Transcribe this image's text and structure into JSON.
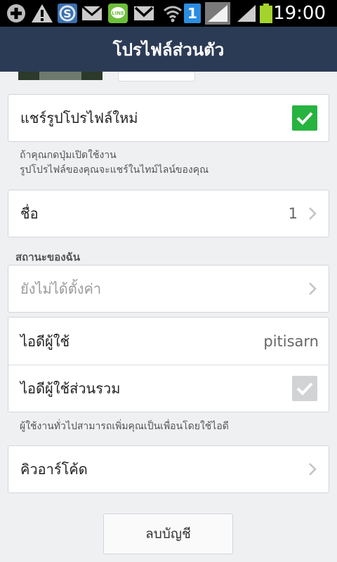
{
  "status_bar": {
    "time": "19:00",
    "notification_badge": "1",
    "battery_color": "#a4d42c",
    "icons": [
      "add-icon",
      "warning-icon",
      "skype-icon",
      "mail-icon",
      "line-icon",
      "gmail-icon",
      "wifi-icon",
      "notification-badge",
      "signal-icon",
      "signal-icon",
      "battery-icon"
    ]
  },
  "header": {
    "title": "โปรไฟล์ส่วนตัว"
  },
  "share_profile": {
    "label": "แชร์รูปโปรไฟล์ใหม่",
    "checked": true,
    "note_line1": "ถ้าคุณกดปุ่มเปิดใช้งาน",
    "note_line2": "รูปโปรไฟล์ของคุณจะแชร์ในไทม์ไลน์ของคุณ"
  },
  "name_row": {
    "label": "ชื่อ",
    "value": "1"
  },
  "status_section": {
    "title": "สถานะของฉัน",
    "placeholder": "ยังไม่ได้ตั้งค่า"
  },
  "user_id": {
    "label": "ไอดีผู้ใช้",
    "value": "pitisarn",
    "public_label": "ไอดีผู้ใช้ส่วนรวม",
    "public_checked": true,
    "note": "ผู้ใช้งานทั่วไปสามารถเพิ่มคุณเป็นเพื่อนโดยใช้ไอดี"
  },
  "qr_row": {
    "label": "คิวอาร์โค้ด"
  },
  "delete_button": {
    "label": "ลบบัญชี"
  },
  "colors": {
    "header_bg": "#2c3b55",
    "accent_green": "#27b33f",
    "background": "#eff0f2"
  }
}
